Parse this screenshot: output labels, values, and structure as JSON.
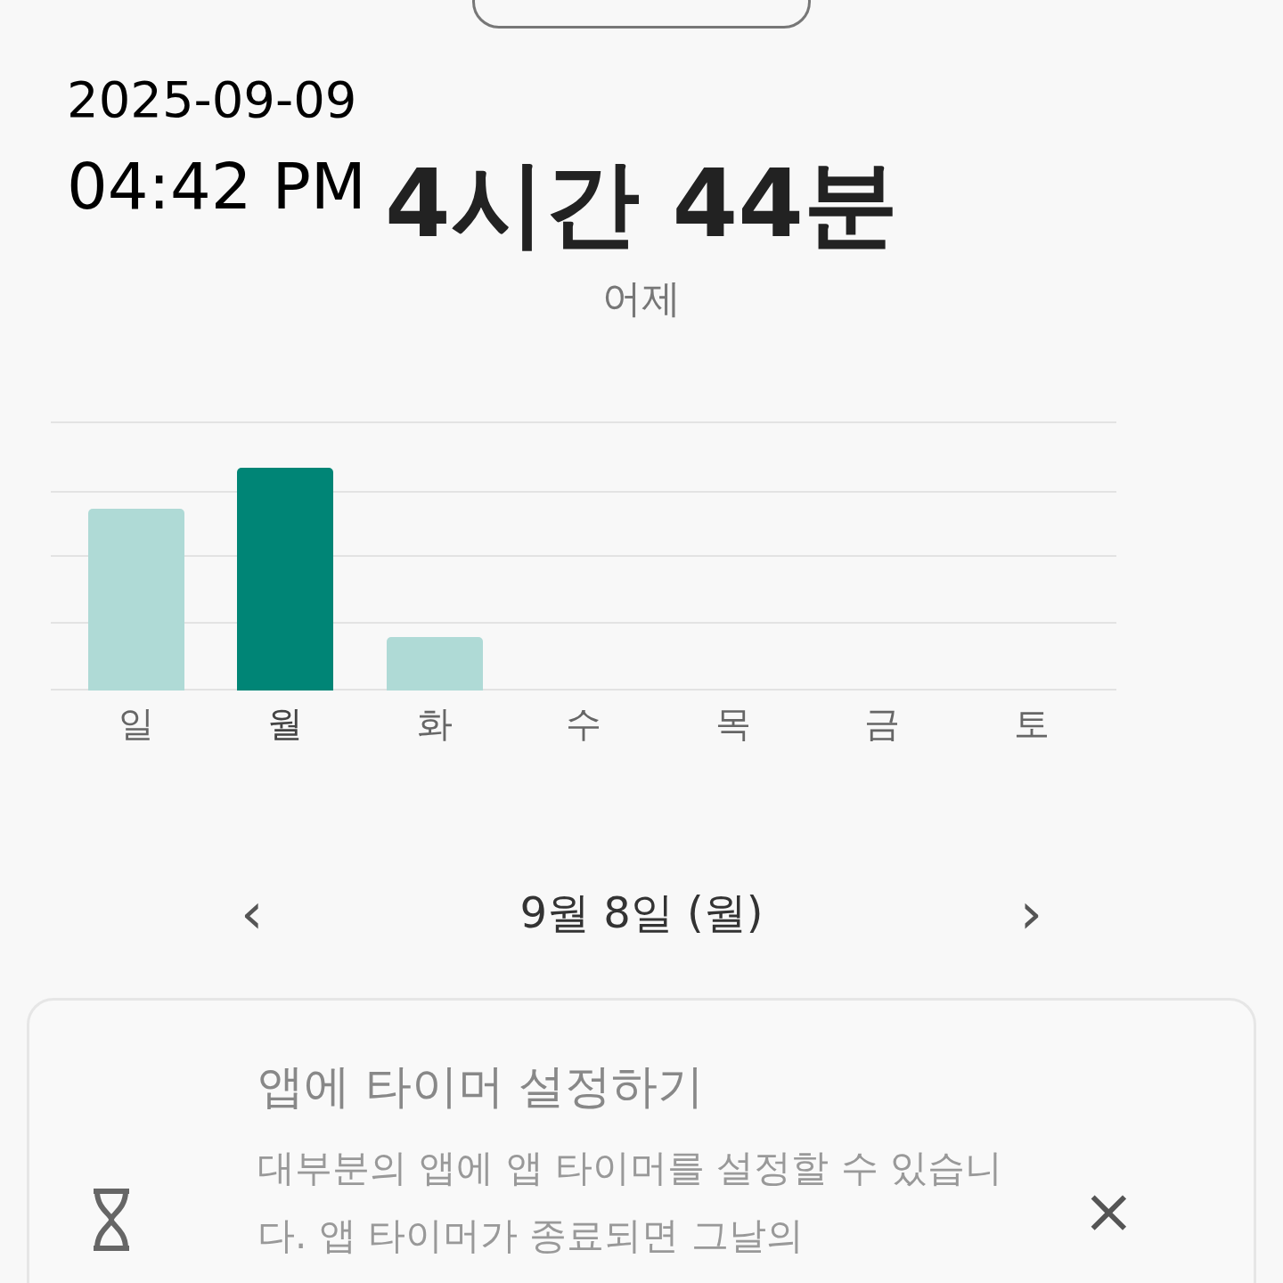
{
  "stamp": {
    "date": "2025-09-09",
    "time": "04:42 PM"
  },
  "summary": {
    "total": "4시간 44분",
    "day_label": "어제"
  },
  "week": [
    {
      "day": "일",
      "selected": false
    },
    {
      "day": "월",
      "selected": true
    },
    {
      "day": "화",
      "selected": false
    },
    {
      "day": "수",
      "selected": false
    },
    {
      "day": "목",
      "selected": false
    },
    {
      "day": "금",
      "selected": false
    },
    {
      "day": "토",
      "selected": false
    }
  ],
  "date_nav": {
    "prev": "‹",
    "date": "9월 8일 (월)",
    "next": "›"
  },
  "tip_card": {
    "title": "앱에 타이머 설정하기",
    "body": "대부분의 앱에 앱 타이머를 설정할 수 있습니다. 앱 타이머가 종료되면 그날의",
    "close": "×"
  }
}
